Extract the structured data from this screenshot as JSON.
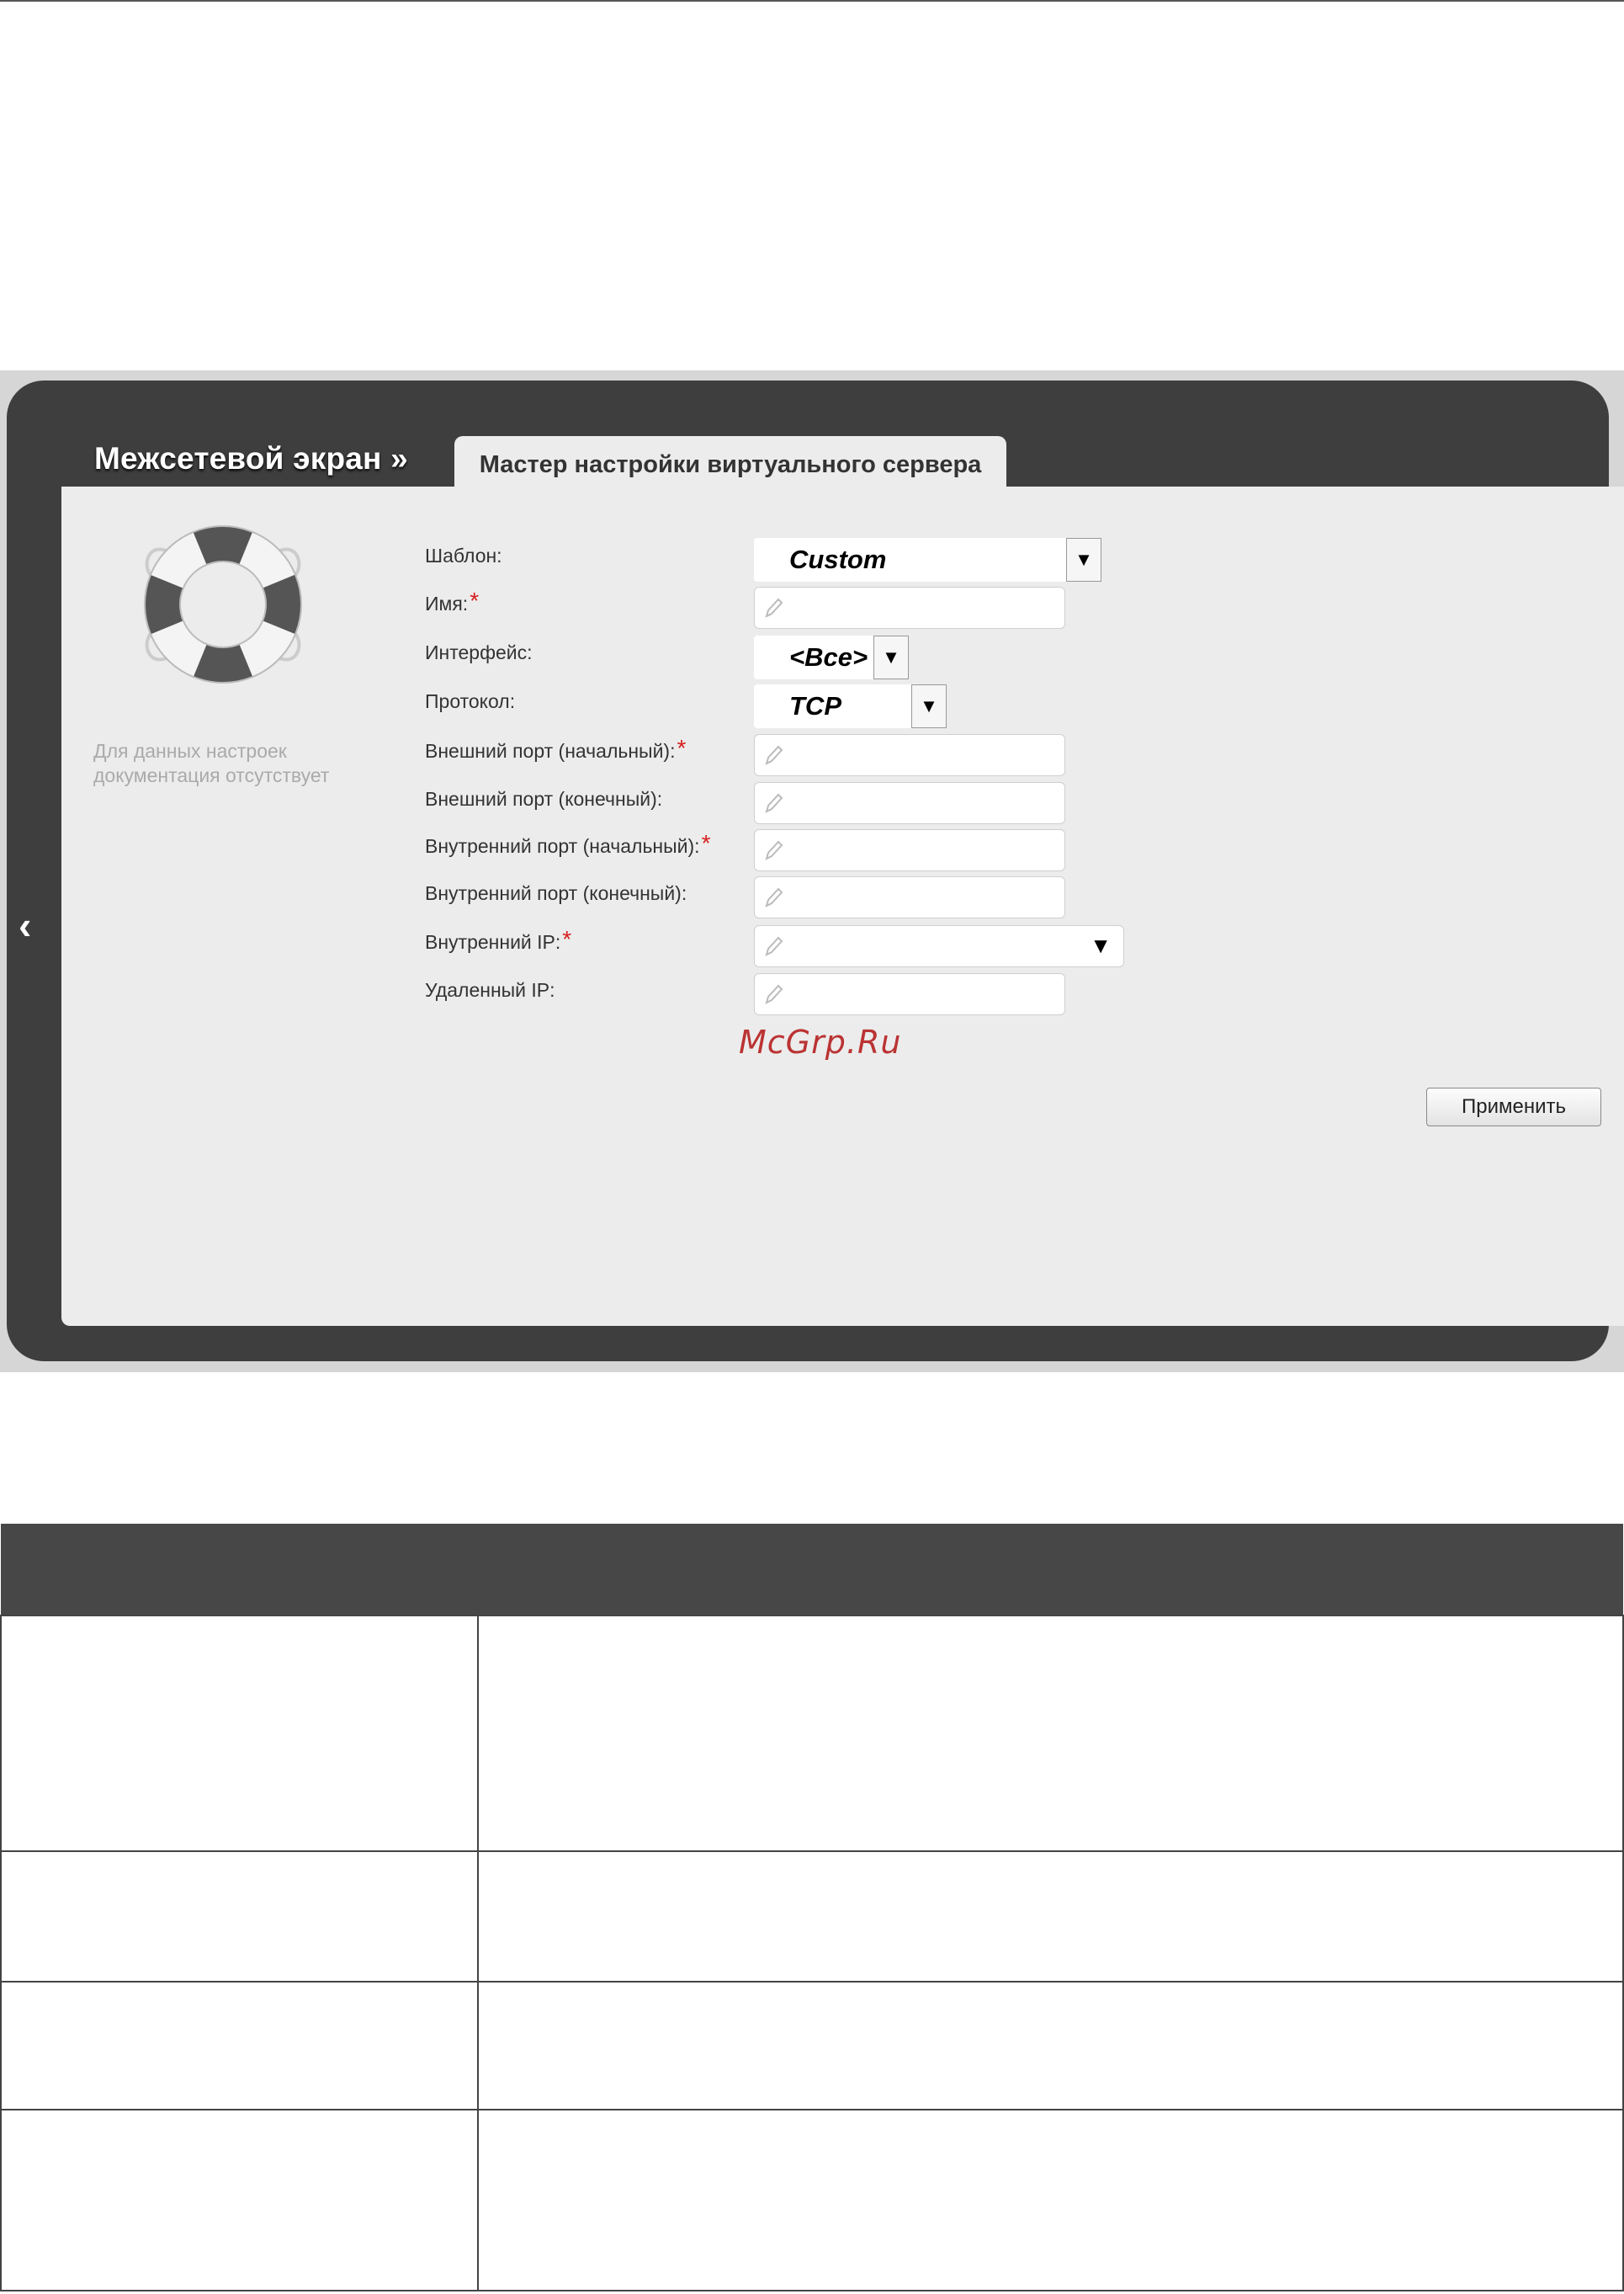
{
  "ui": {
    "breadcrumb": "Межсетевой экран »",
    "tab_label": "Мастер настройки виртуального сервера",
    "doc_note": "Для данных настроек документация отсутствует",
    "labels": {
      "template": "Шаблон:",
      "name": "Имя:",
      "interface": "Интерфейс:",
      "protocol": "Протокол:",
      "ext_port_start": "Внешний порт (начальный):",
      "ext_port_end": "Внешний порт (конечный):",
      "int_port_start": "Внутренний порт (начальный):",
      "int_port_end": "Внутренний порт (конечный):",
      "internal_ip": "Внутренний IP:",
      "remote_ip": "Удаленный IP:"
    },
    "required_mark": "*",
    "values": {
      "template": "Custom",
      "interface": "<Все>",
      "protocol": "TCP",
      "name": "",
      "ext_port_start": "",
      "ext_port_end": "",
      "int_port_start": "",
      "int_port_end": "",
      "internal_ip": "",
      "remote_ip": ""
    },
    "apply_button": "Применить",
    "back_arrow": "‹",
    "dropdown_arrow": "▼"
  },
  "watermark": "McGrp.Ru",
  "icons": [
    "lifebuoy-icon",
    "pencil-icon",
    "back-arrow-icon",
    "dropdown-arrow-icon"
  ],
  "colors": {
    "panel_dark": "#3e3e3e",
    "content_bg": "#ececec",
    "required": "#d81e1e",
    "table_header": "#474747"
  }
}
